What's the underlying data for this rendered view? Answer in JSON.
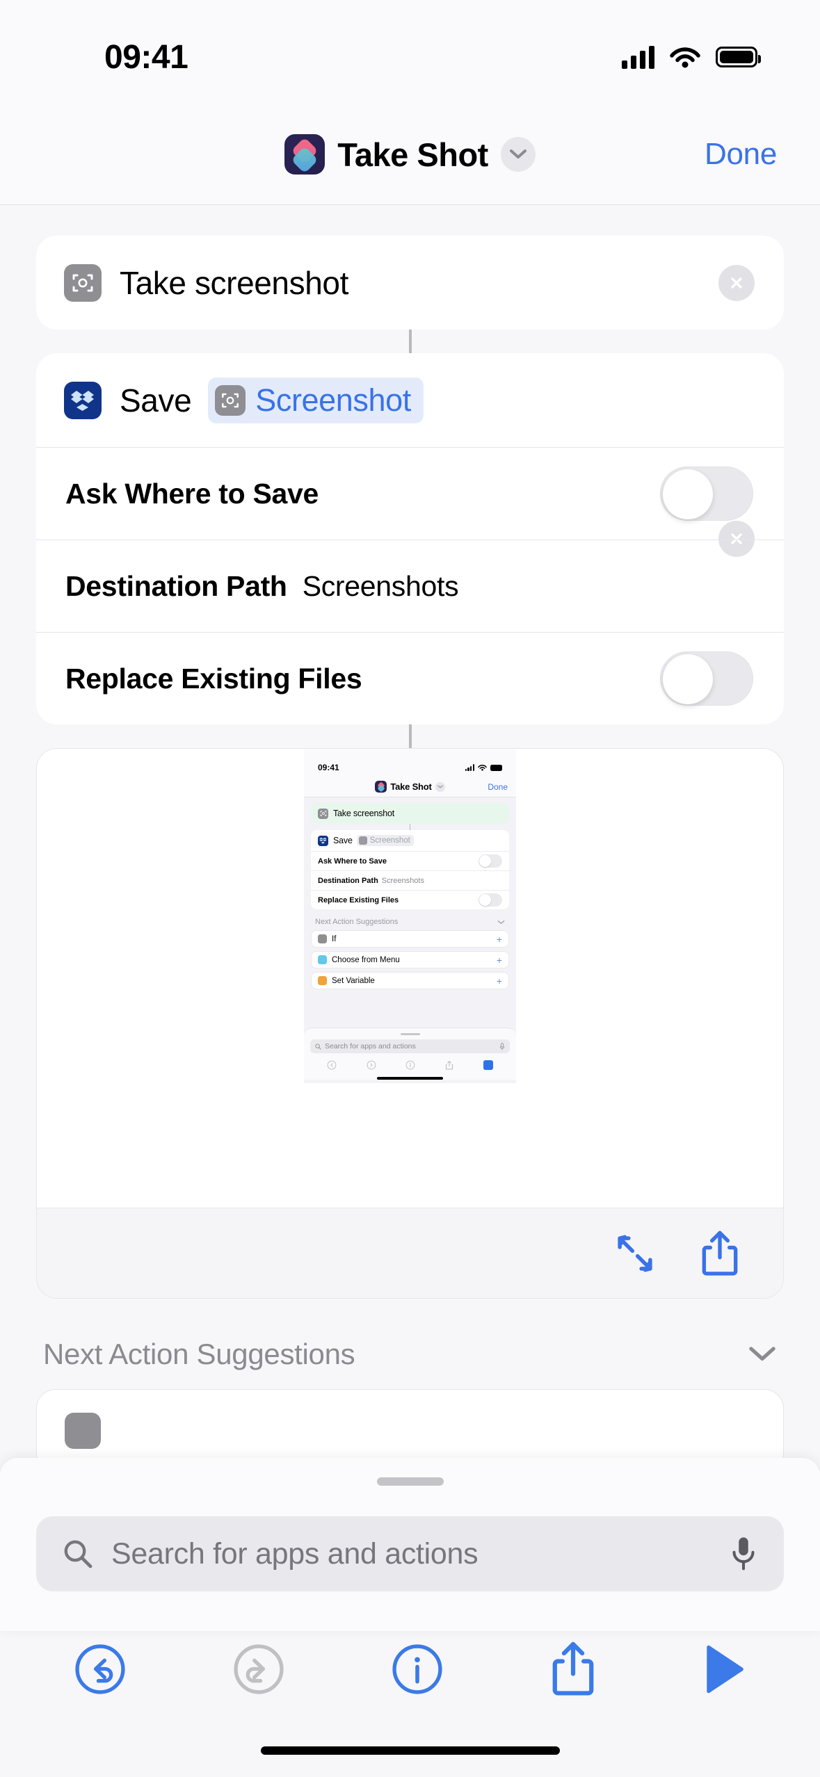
{
  "status_bar": {
    "time": "09:41",
    "signal": "signal-bars",
    "wifi": "wifi-icon",
    "battery": "battery-icon"
  },
  "nav": {
    "app_icon": "shortcuts-icon",
    "title": "Take Shot",
    "chevron": "chevron-down-icon",
    "done_label": "Done"
  },
  "actions": [
    {
      "icon": "screenshot-icon",
      "label": "Take screenshot",
      "remove": "close-icon"
    },
    {
      "icon": "dropbox-icon",
      "label": "Save",
      "variable_icon": "screenshot-icon",
      "variable_label": "Screenshot",
      "remove": "close-icon",
      "params": [
        {
          "label": "Ask Where to Save",
          "control": "toggle",
          "value": "off"
        },
        {
          "label": "Destination Path",
          "control": "text",
          "value": "Screenshots"
        },
        {
          "label": "Replace Existing Files",
          "control": "toggle",
          "value": "off"
        }
      ]
    }
  ],
  "preview": {
    "expand_icon": "expand-icon",
    "share_icon": "share-icon",
    "inner": {
      "status_time": "09:41",
      "title": "Take Shot",
      "done_label": "Done",
      "actions": [
        {
          "label": "Take screenshot"
        },
        {
          "label": "Save",
          "variable": "Screenshot"
        }
      ],
      "params": [
        {
          "label": "Ask Where to Save",
          "value": ""
        },
        {
          "label": "Destination Path",
          "value": "Screenshots"
        },
        {
          "label": "Replace Existing Files",
          "value": ""
        }
      ],
      "suggestions_title": "Next Action Suggestions",
      "suggestions": [
        {
          "label": "If",
          "color": "#8e8e93",
          "add": "+"
        },
        {
          "label": "Choose from Menu",
          "color": "#62c9e8",
          "add": "+"
        },
        {
          "label": "Set Variable",
          "color": "#f0a23c",
          "add": "+"
        }
      ],
      "search_placeholder": "Search for apps and actions"
    }
  },
  "suggestions_section": {
    "title": "Next Action Suggestions",
    "chevron": "chevron-down-icon"
  },
  "search": {
    "placeholder": "Search for apps and actions",
    "search_icon": "search-icon",
    "mic_icon": "microphone-icon"
  },
  "toolbar": [
    {
      "name": "undo-button",
      "icon": "undo-icon",
      "state": "enabled"
    },
    {
      "name": "redo-button",
      "icon": "redo-icon",
      "state": "disabled"
    },
    {
      "name": "info-button",
      "icon": "info-icon",
      "state": "enabled"
    },
    {
      "name": "share-button",
      "icon": "share-icon",
      "state": "enabled"
    },
    {
      "name": "play-button",
      "icon": "play-icon",
      "state": "enabled"
    }
  ],
  "colors": {
    "accent": "#3a72e8",
    "toolbar_blue": "#3b7ae8",
    "disabled": "#bfbfc4",
    "card": "#ffffff",
    "background": "#f2f2f7"
  }
}
